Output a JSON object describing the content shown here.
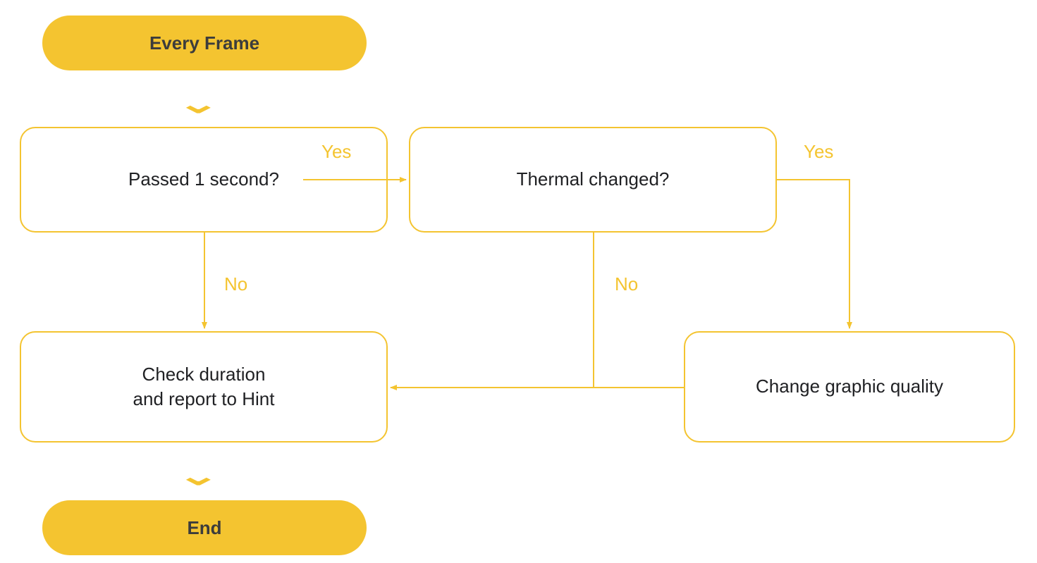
{
  "colors": {
    "accent": "#f4c430",
    "node_text": "#202124",
    "terminal_text": "#3c3c3c"
  },
  "nodes": {
    "start": {
      "label": "Every Frame"
    },
    "decision1": {
      "label": "Passed 1 second?"
    },
    "decision2": {
      "label": "Thermal changed?"
    },
    "process_report": {
      "label_line1": "Check duration",
      "label_line2": "and report to Hint"
    },
    "process_quality": {
      "label": "Change graphic quality"
    },
    "end": {
      "label": "End"
    }
  },
  "edges": {
    "d1_yes": "Yes",
    "d1_no": "No",
    "d2_yes": "Yes",
    "d2_no": "No"
  }
}
